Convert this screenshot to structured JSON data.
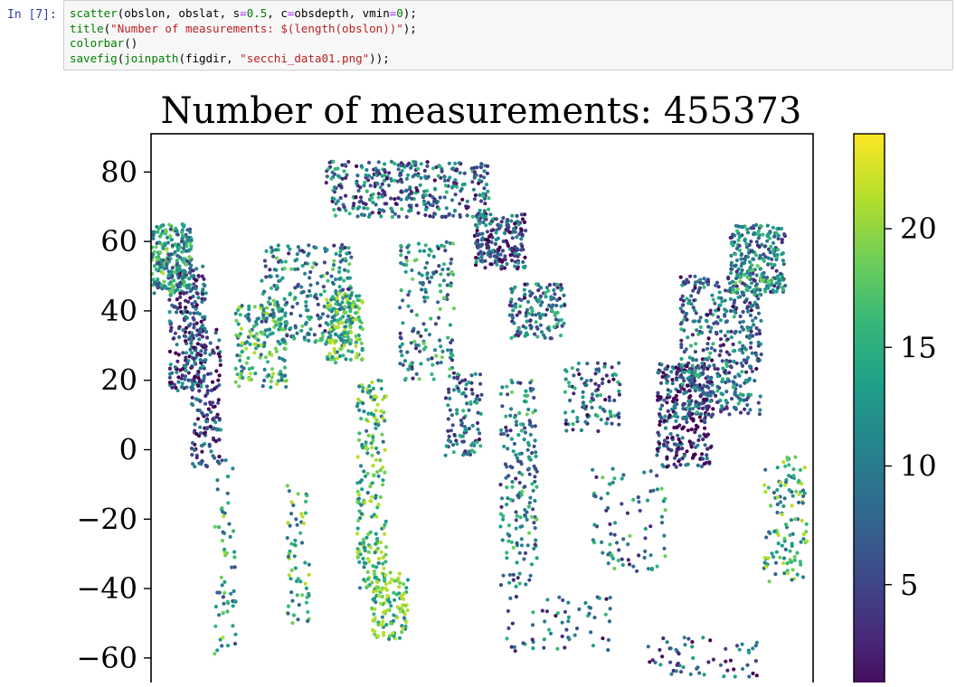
{
  "cell": {
    "prompt": "In [7]:",
    "code": [
      {
        "parts": [
          {
            "t": "scatter",
            "c": "k"
          },
          {
            "t": "(obslon, obslat, s",
            "c": ""
          },
          {
            "t": "=",
            "c": "o"
          },
          {
            "t": "0.5",
            "c": "n"
          },
          {
            "t": ", c",
            "c": ""
          },
          {
            "t": "=",
            "c": "o"
          },
          {
            "t": "obsdepth, vmin",
            "c": ""
          },
          {
            "t": "=",
            "c": "o"
          },
          {
            "t": "0",
            "c": "n"
          },
          {
            "t": ");",
            "c": ""
          }
        ]
      },
      {
        "parts": [
          {
            "t": "title",
            "c": "k"
          },
          {
            "t": "(",
            "c": ""
          },
          {
            "t": "\"Number of measurements: $(length(obslon))\"",
            "c": "s"
          },
          {
            "t": ");",
            "c": ""
          }
        ]
      },
      {
        "parts": [
          {
            "t": "colorbar",
            "c": "k"
          },
          {
            "t": "()",
            "c": ""
          }
        ]
      },
      {
        "parts": [
          {
            "t": "savefig",
            "c": "k"
          },
          {
            "t": "(",
            "c": ""
          },
          {
            "t": "joinpath",
            "c": "k"
          },
          {
            "t": "(figdir, ",
            "c": ""
          },
          {
            "t": "\"secchi_data01.png\"",
            "c": "s"
          },
          {
            "t": "));",
            "c": ""
          }
        ]
      }
    ]
  },
  "chart_data": {
    "type": "scatter",
    "title": "Number of measurements: 455373",
    "xlabel": "",
    "ylabel": "",
    "yticks": [
      80,
      60,
      40,
      20,
      0,
      -20,
      -40,
      -60
    ],
    "ylim": [
      -68,
      91
    ],
    "xlim": [
      -180,
      180
    ],
    "colorbar": {
      "colormap": "viridis",
      "ticks": [
        20,
        15,
        10,
        5
      ],
      "vmin": 0,
      "vmax": 24,
      "colors": [
        "#440154",
        "#482878",
        "#3e4989",
        "#31688e",
        "#26828e",
        "#1f9e89",
        "#35b779",
        "#6ece58",
        "#b5de2b",
        "#fde725"
      ]
    },
    "grid": false
  }
}
